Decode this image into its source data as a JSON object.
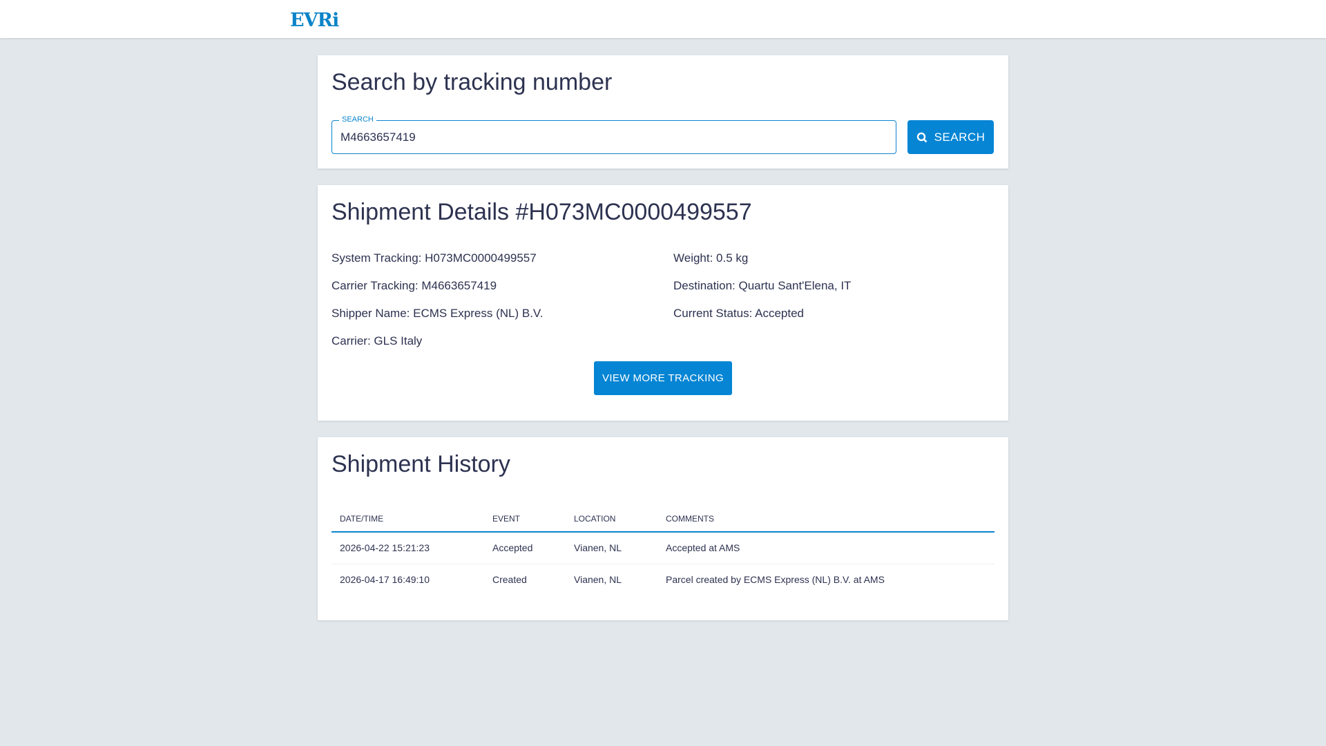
{
  "header": {
    "logo": "EVRi"
  },
  "search": {
    "title": "Search by tracking number",
    "field_label": "SEARCH",
    "value": "M4663657419",
    "button_label": "SEARCH"
  },
  "details": {
    "title": "Shipment Details #H073MC0000499557",
    "system_tracking": "System Tracking: H073MC0000499557",
    "carrier_tracking": "Carrier Tracking: M4663657419",
    "shipper_name": "Shipper Name: ECMS Express (NL) B.V.",
    "carrier": "Carrier: GLS Italy",
    "weight": "Weight: 0.5 kg",
    "destination": "Destination: Quartu Sant'Elena, IT",
    "status": "Current Status: Accepted",
    "button_label": "VIEW MORE TRACKING"
  },
  "history": {
    "title": "Shipment History",
    "columns": [
      "DATE/TIME",
      "EVENT",
      "LOCATION",
      "COMMENTS"
    ],
    "rows": [
      [
        "2026-04-22 15:21:23",
        "Accepted",
        "Vianen, NL",
        "Accepted at AMS"
      ],
      [
        "2026-04-17 16:49:10",
        "Created",
        "Vianen, NL",
        "Parcel created by ECMS Express (NL) B.V. at AMS"
      ]
    ]
  },
  "colors": {
    "accent": "#0585d4",
    "text": "#2d3250",
    "background": "#e2e7eb"
  }
}
